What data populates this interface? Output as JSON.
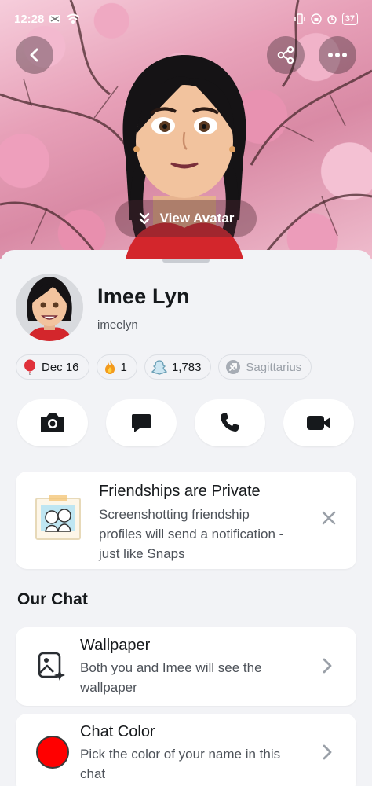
{
  "status_bar": {
    "time": "12:28",
    "battery": "37"
  },
  "hero": {
    "view_avatar_label": "View Avatar"
  },
  "profile": {
    "display_name": "Imee Lyn",
    "username": "imeelyn"
  },
  "chips": [
    {
      "icon": "balloon-icon",
      "label": "Dec 16"
    },
    {
      "icon": "fire-icon",
      "label": "1"
    },
    {
      "icon": "snap-score-icon",
      "label": "1,783"
    },
    {
      "icon": "zodiac-icon",
      "label": "Sagittarius"
    }
  ],
  "actions": [
    "camera-icon",
    "chat-icon",
    "phone-icon",
    "video-icon"
  ],
  "privacy_card": {
    "title": "Friendships are Private",
    "body": "Screenshotting friendship profiles will send a notification - just like Snaps"
  },
  "our_chat": {
    "title": "Our Chat",
    "wallpaper": {
      "title": "Wallpaper",
      "subtitle": "Both you and Imee will see the wallpaper"
    },
    "chat_color": {
      "title": "Chat Color",
      "subtitle": "Pick the color of your name in this chat",
      "color": "#ff0000"
    }
  },
  "colors": {
    "accent_red": "#ff0000",
    "card_bg": "#ffffff",
    "page_bg": "#f2f3f6"
  }
}
